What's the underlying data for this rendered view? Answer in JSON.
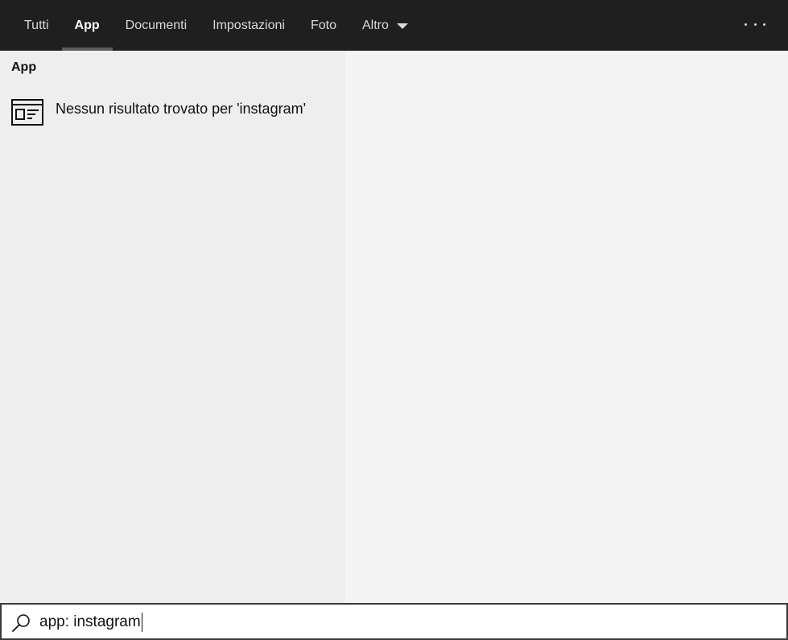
{
  "tabs": [
    {
      "label": "Tutti",
      "active": false
    },
    {
      "label": "App",
      "active": true
    },
    {
      "label": "Documenti",
      "active": false
    },
    {
      "label": "Impostazioni",
      "active": false
    },
    {
      "label": "Foto",
      "active": false
    },
    {
      "label": "Altro",
      "active": false,
      "dropdown": true
    }
  ],
  "more_icon": "more-horizontal-icon",
  "results": {
    "section_title": "App",
    "items": [
      {
        "icon": "app-window-icon",
        "text": "Nessun risultato trovato per 'instagram'"
      }
    ]
  },
  "search": {
    "icon": "search-icon",
    "value": "app: instagram"
  },
  "colors": {
    "topbar": "#1f1f1f",
    "active_indicator": "#5c5c5c",
    "left_pane": "#eeeeee",
    "right_pane": "#f4f4f4"
  }
}
